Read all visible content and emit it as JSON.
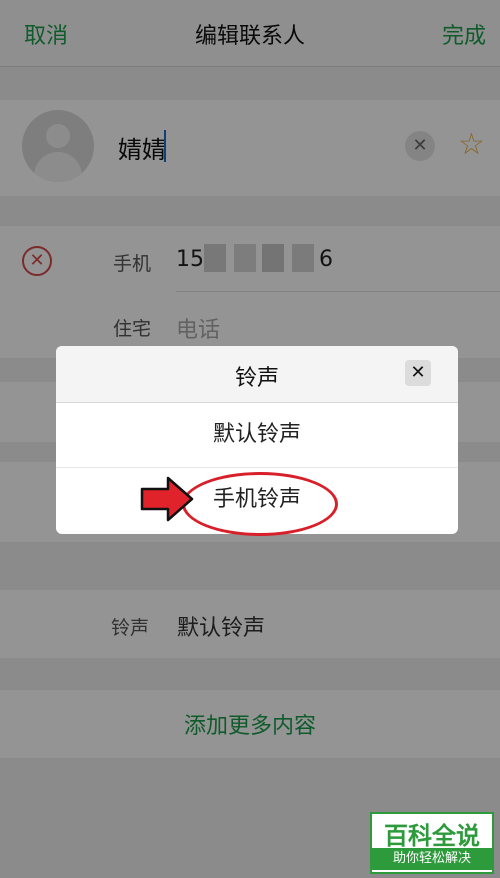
{
  "nav": {
    "cancel": "取消",
    "title": "编辑联系人",
    "done": "完成"
  },
  "contact": {
    "name": "婧婧"
  },
  "phone": {
    "label": "手机",
    "value_prefix": "15",
    "value_suffix": "6"
  },
  "home": {
    "label": "住宅",
    "placeholder": "电话"
  },
  "ringtone": {
    "label": "铃声",
    "value": "默认铃声"
  },
  "add_more": "添加更多内容",
  "dialog": {
    "title": "铃声",
    "options": [
      "默认铃声",
      "手机铃声"
    ]
  },
  "icons": {
    "close": "close-icon",
    "star": "star-icon",
    "remove": "remove-circle-icon",
    "avatar": "person-icon",
    "arrow": "arrow-right-icon"
  },
  "colors": {
    "accent": "#1a9e4a",
    "highlight": "#d8202b",
    "star": "#e0b64a"
  },
  "watermark": {
    "top": "百科全说",
    "bottom": "助你轻松解决"
  }
}
